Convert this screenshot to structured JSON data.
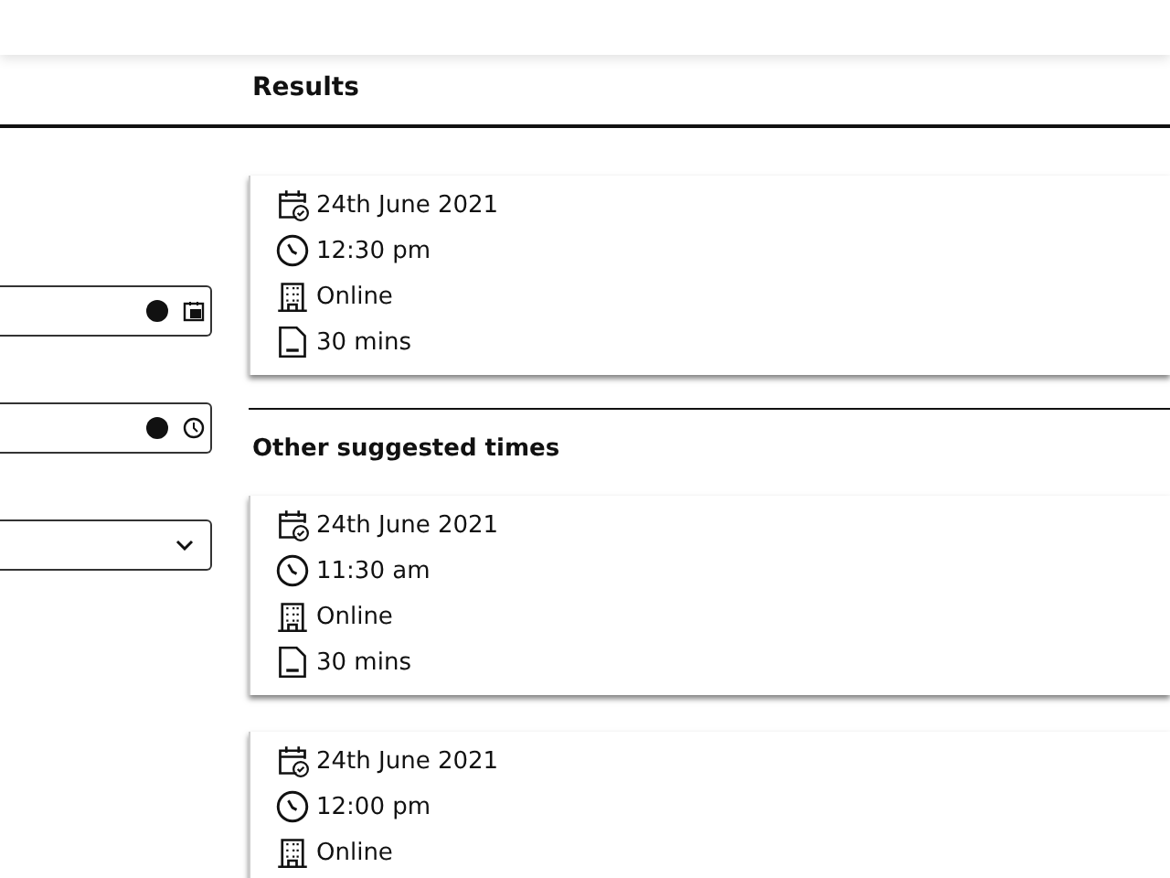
{
  "results_heading": "Results",
  "filters": [
    {
      "kind": "date"
    },
    {
      "kind": "time"
    },
    {
      "kind": "select"
    }
  ],
  "best_result": {
    "date": "24th June 2021",
    "time": "12:30 pm",
    "location": "Online",
    "duration": "30 mins"
  },
  "other_heading": "Other suggested times",
  "suggestions": [
    {
      "date": "24th June 2021",
      "time": "11:30 am",
      "location": "Online",
      "duration": "30 mins"
    },
    {
      "date": "24th June 2021",
      "time": "12:00 pm",
      "location": "Online"
    }
  ]
}
